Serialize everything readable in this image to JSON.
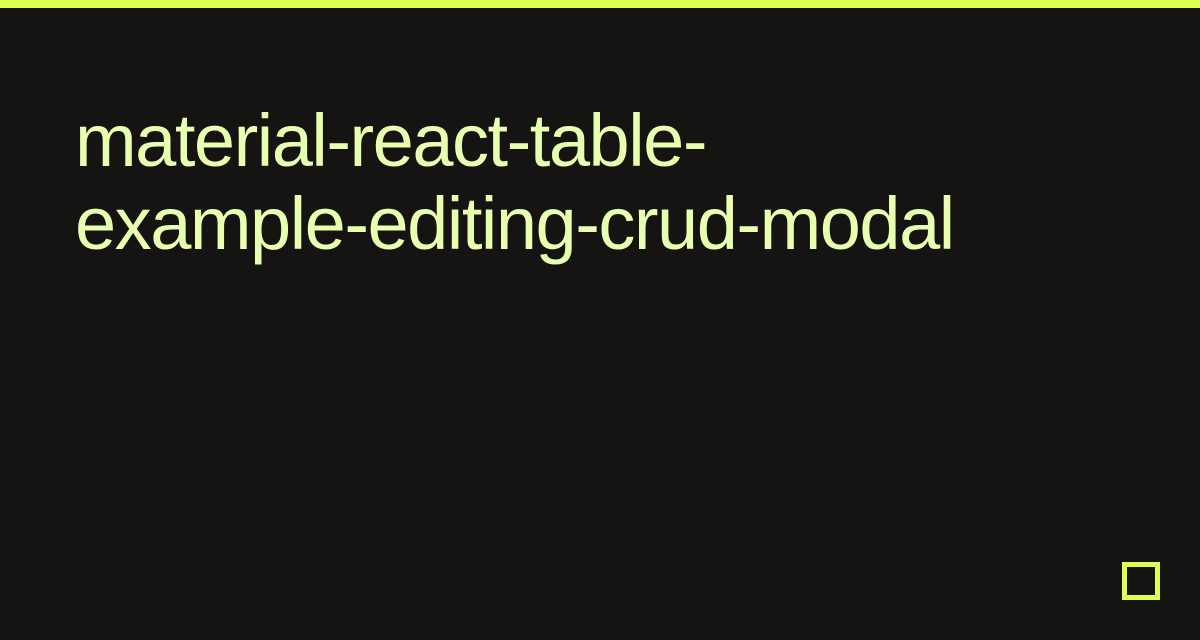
{
  "title": "material-react-table-example-editing-crud-modal",
  "colors": {
    "accent": "#dcff50",
    "titleText": "#e9ffb0",
    "background": "#151413"
  }
}
